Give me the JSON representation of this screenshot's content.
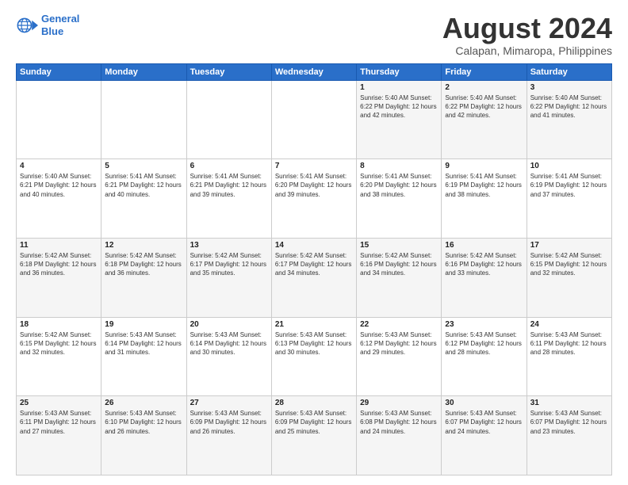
{
  "logo": {
    "line1": "General",
    "line2": "Blue"
  },
  "title": "August 2024",
  "subtitle": "Calapan, Mimaropa, Philippines",
  "weekdays": [
    "Sunday",
    "Monday",
    "Tuesday",
    "Wednesday",
    "Thursday",
    "Friday",
    "Saturday"
  ],
  "weeks": [
    [
      {
        "date": "",
        "info": ""
      },
      {
        "date": "",
        "info": ""
      },
      {
        "date": "",
        "info": ""
      },
      {
        "date": "",
        "info": ""
      },
      {
        "date": "1",
        "info": "Sunrise: 5:40 AM\nSunset: 6:22 PM\nDaylight: 12 hours\nand 42 minutes."
      },
      {
        "date": "2",
        "info": "Sunrise: 5:40 AM\nSunset: 6:22 PM\nDaylight: 12 hours\nand 42 minutes."
      },
      {
        "date": "3",
        "info": "Sunrise: 5:40 AM\nSunset: 6:22 PM\nDaylight: 12 hours\nand 41 minutes."
      }
    ],
    [
      {
        "date": "4",
        "info": "Sunrise: 5:40 AM\nSunset: 6:21 PM\nDaylight: 12 hours\nand 40 minutes."
      },
      {
        "date": "5",
        "info": "Sunrise: 5:41 AM\nSunset: 6:21 PM\nDaylight: 12 hours\nand 40 minutes."
      },
      {
        "date": "6",
        "info": "Sunrise: 5:41 AM\nSunset: 6:21 PM\nDaylight: 12 hours\nand 39 minutes."
      },
      {
        "date": "7",
        "info": "Sunrise: 5:41 AM\nSunset: 6:20 PM\nDaylight: 12 hours\nand 39 minutes."
      },
      {
        "date": "8",
        "info": "Sunrise: 5:41 AM\nSunset: 6:20 PM\nDaylight: 12 hours\nand 38 minutes."
      },
      {
        "date": "9",
        "info": "Sunrise: 5:41 AM\nSunset: 6:19 PM\nDaylight: 12 hours\nand 38 minutes."
      },
      {
        "date": "10",
        "info": "Sunrise: 5:41 AM\nSunset: 6:19 PM\nDaylight: 12 hours\nand 37 minutes."
      }
    ],
    [
      {
        "date": "11",
        "info": "Sunrise: 5:42 AM\nSunset: 6:18 PM\nDaylight: 12 hours\nand 36 minutes."
      },
      {
        "date": "12",
        "info": "Sunrise: 5:42 AM\nSunset: 6:18 PM\nDaylight: 12 hours\nand 36 minutes."
      },
      {
        "date": "13",
        "info": "Sunrise: 5:42 AM\nSunset: 6:17 PM\nDaylight: 12 hours\nand 35 minutes."
      },
      {
        "date": "14",
        "info": "Sunrise: 5:42 AM\nSunset: 6:17 PM\nDaylight: 12 hours\nand 34 minutes."
      },
      {
        "date": "15",
        "info": "Sunrise: 5:42 AM\nSunset: 6:16 PM\nDaylight: 12 hours\nand 34 minutes."
      },
      {
        "date": "16",
        "info": "Sunrise: 5:42 AM\nSunset: 6:16 PM\nDaylight: 12 hours\nand 33 minutes."
      },
      {
        "date": "17",
        "info": "Sunrise: 5:42 AM\nSunset: 6:15 PM\nDaylight: 12 hours\nand 32 minutes."
      }
    ],
    [
      {
        "date": "18",
        "info": "Sunrise: 5:42 AM\nSunset: 6:15 PM\nDaylight: 12 hours\nand 32 minutes."
      },
      {
        "date": "19",
        "info": "Sunrise: 5:43 AM\nSunset: 6:14 PM\nDaylight: 12 hours\nand 31 minutes."
      },
      {
        "date": "20",
        "info": "Sunrise: 5:43 AM\nSunset: 6:14 PM\nDaylight: 12 hours\nand 30 minutes."
      },
      {
        "date": "21",
        "info": "Sunrise: 5:43 AM\nSunset: 6:13 PM\nDaylight: 12 hours\nand 30 minutes."
      },
      {
        "date": "22",
        "info": "Sunrise: 5:43 AM\nSunset: 6:12 PM\nDaylight: 12 hours\nand 29 minutes."
      },
      {
        "date": "23",
        "info": "Sunrise: 5:43 AM\nSunset: 6:12 PM\nDaylight: 12 hours\nand 28 minutes."
      },
      {
        "date": "24",
        "info": "Sunrise: 5:43 AM\nSunset: 6:11 PM\nDaylight: 12 hours\nand 28 minutes."
      }
    ],
    [
      {
        "date": "25",
        "info": "Sunrise: 5:43 AM\nSunset: 6:11 PM\nDaylight: 12 hours\nand 27 minutes."
      },
      {
        "date": "26",
        "info": "Sunrise: 5:43 AM\nSunset: 6:10 PM\nDaylight: 12 hours\nand 26 minutes."
      },
      {
        "date": "27",
        "info": "Sunrise: 5:43 AM\nSunset: 6:09 PM\nDaylight: 12 hours\nand 26 minutes."
      },
      {
        "date": "28",
        "info": "Sunrise: 5:43 AM\nSunset: 6:09 PM\nDaylight: 12 hours\nand 25 minutes."
      },
      {
        "date": "29",
        "info": "Sunrise: 5:43 AM\nSunset: 6:08 PM\nDaylight: 12 hours\nand 24 minutes."
      },
      {
        "date": "30",
        "info": "Sunrise: 5:43 AM\nSunset: 6:07 PM\nDaylight: 12 hours\nand 24 minutes."
      },
      {
        "date": "31",
        "info": "Sunrise: 5:43 AM\nSunset: 6:07 PM\nDaylight: 12 hours\nand 23 minutes."
      }
    ]
  ],
  "colors": {
    "header_bg": "#2a6fc9",
    "accent": "#2a6fc9"
  }
}
